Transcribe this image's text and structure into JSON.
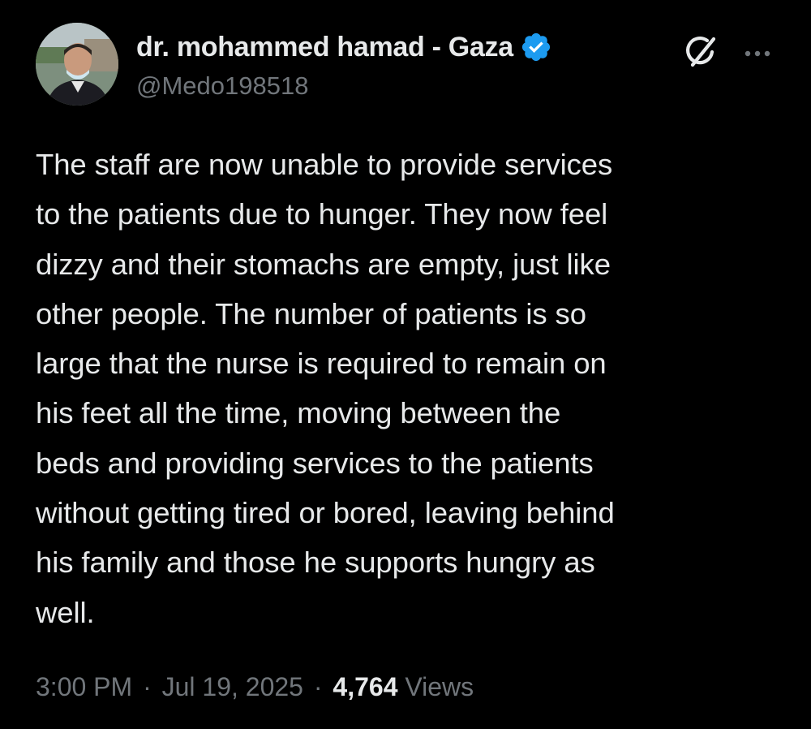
{
  "author": {
    "display_name": "dr. mohammed hamad - Gaza",
    "handle": "@Medo198518",
    "verified": true,
    "verified_color": "#1d9bf0"
  },
  "actions": {
    "grok_icon": "grok-icon",
    "more_icon": "more-icon"
  },
  "tweet": {
    "lines": [
      "The staff are now unable to provide services",
      "to the patients due to hunger. They now feel",
      "dizzy and their stomachs are empty, just like",
      "other people. The number of patients is so",
      "large that the nurse is required to remain on",
      "his feet all the time, moving between the",
      "beds and providing services to the patients",
      "without getting tired or bored, leaving behind",
      "his family and those he supports hungry as",
      "well."
    ]
  },
  "meta": {
    "time": "3:00 PM",
    "separator": "·",
    "date": "Jul 19, 2025",
    "views_count": "4,764",
    "views_label": "Views"
  },
  "colors": {
    "background": "#000000",
    "primary_text": "#e7e9ea",
    "secondary_text": "#71767b"
  }
}
